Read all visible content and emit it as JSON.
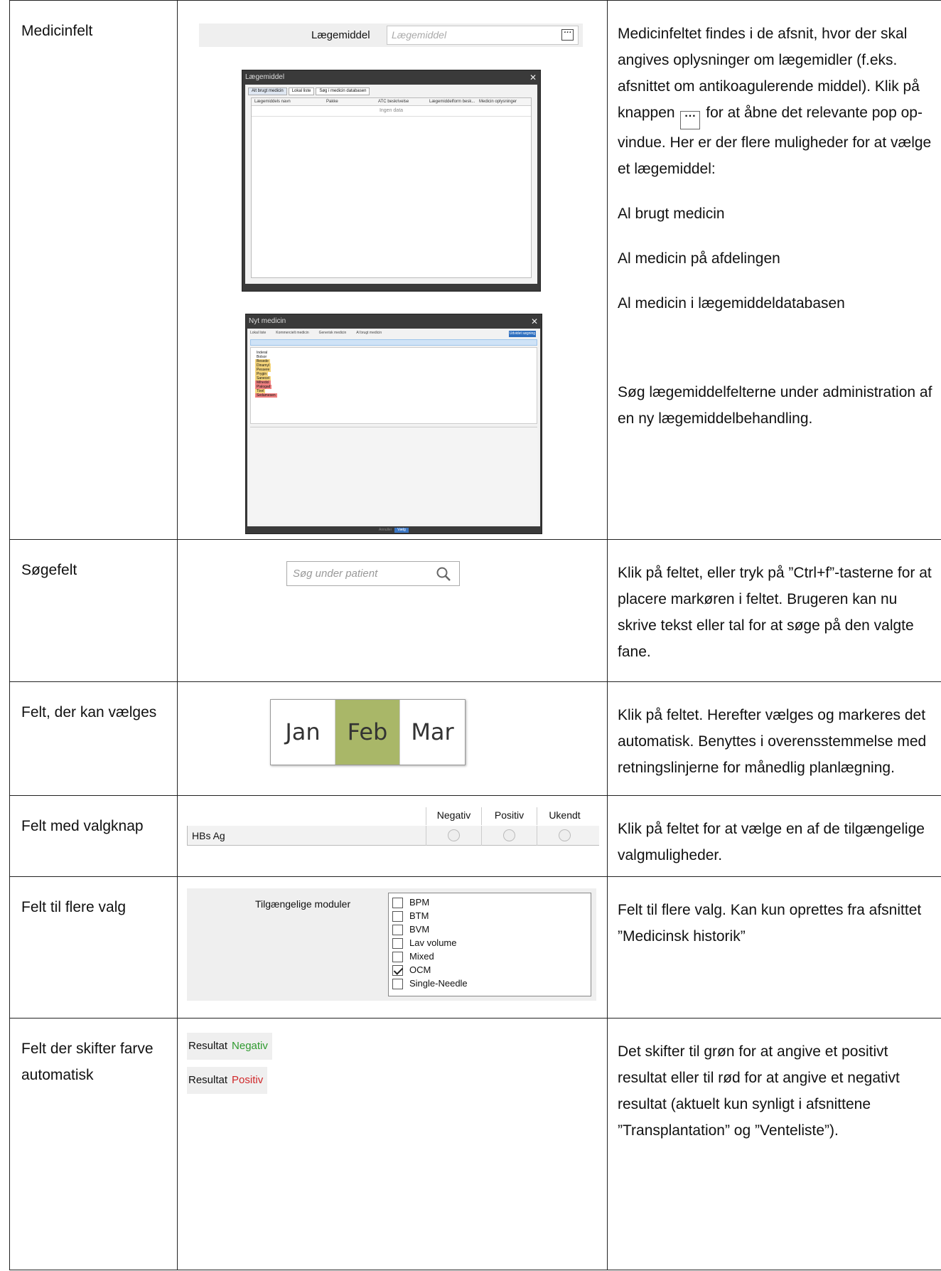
{
  "rows": [
    {
      "label": "Medicinfelt",
      "desc": {
        "p1_before": "Medicinfeltet findes i de afsnit, hvor der skal angives oplysninger om lægemidler (f.eks. afsnittet om antikoagulerende middel). Klik på knappen",
        "p1_button": "···",
        "p1_after": "for at åbne det relevante pop op-vindue. Her er der flere muligheder for at vælge et lægemiddel:",
        "p2": "Al brugt medicin",
        "p3": "Al medicin på afdelingen",
        "p4": "Al medicin i lægemiddeldatabasen",
        "p5": "Søg lægemiddelfelterne under administration af en ny lægemiddelbehandling."
      },
      "widget": {
        "field_label": "Lægemiddel",
        "field_placeholder": "Lægemiddel",
        "field_button": "···",
        "popup": {
          "title": "Lægemiddel",
          "close": "✕",
          "tabs": [
            "Alt brugt medicin",
            "Lokal liste",
            "Søg i medicin databasen"
          ],
          "columns": [
            "Lægemiddels navn",
            "Pakke",
            "ATC beskrivelse",
            "Lægemiddelform besk...",
            "Medicin oplysninger"
          ],
          "empty": "Ingen data"
        },
        "new_med": {
          "title": "Nyt medicin",
          "close": "✕",
          "options": [
            "Lokal liste",
            "Kommercielt medicin",
            "Generisk medicin",
            "Al brugt medicin"
          ],
          "action": "Udvidet søgning",
          "items": [
            "Inderal",
            "Bolsor",
            "Besede",
            "Dinamyl",
            "Pessere",
            "Prygin",
            "Sanecel",
            "Mihedol",
            "Plalogad",
            "Tixel",
            "Sedamesen"
          ],
          "cancel": "Annuller",
          "ok": "Vælg"
        }
      }
    },
    {
      "label": "Søgefelt",
      "desc": "Klik på feltet, eller tryk på ”Ctrl+f”-tasterne for at placere markøren i feltet. Brugeren kan nu skrive tekst eller tal for at søge på den valgte fane.",
      "widget": {
        "placeholder": "Søg under patient",
        "icon": "search-icon"
      }
    },
    {
      "label": "Felt, der kan vælges",
      "desc": "Klik på feltet. Herefter vælges og markeres det automatisk. Benyttes i overensstemmelse med retningslinjerne for månedlig planlægning.",
      "widget": {
        "months": [
          "Jan",
          "Feb",
          "Mar"
        ],
        "selected": "Feb",
        "selected_color": "#a9b768"
      }
    },
    {
      "label": "Felt med valgknap",
      "desc": "Klik på feltet for at vælge en af de tilgængelige valgmuligheder.",
      "widget": {
        "columns": [
          "Negativ",
          "Positiv",
          "Ukendt"
        ],
        "row_label": "HBs Ag"
      }
    },
    {
      "label": "Felt til flere valg",
      "desc": "Felt til flere valg. Kan kun oprettes fra afsnittet ”Medicinsk historik”",
      "widget": {
        "label": "Tilgængelige moduler",
        "options": [
          {
            "text": "BPM",
            "checked": false
          },
          {
            "text": "BTM",
            "checked": false
          },
          {
            "text": "BVM",
            "checked": false
          },
          {
            "text": "Lav volume",
            "checked": false
          },
          {
            "text": "Mixed",
            "checked": false
          },
          {
            "text": "OCM",
            "checked": true
          },
          {
            "text": "Single-Needle",
            "checked": false
          }
        ]
      }
    },
    {
      "label": "Felt der skifter farve automatisk",
      "desc": "Det skifter til grøn for at angive et positivt resultat eller til rød for at angive et negativt resultat (aktuelt kun synligt i afsnittene ”Transplantation” og ”Venteliste”).",
      "widget": {
        "items": [
          {
            "label": "Resultat",
            "value": "Negativ",
            "color": "#2e9a2e"
          },
          {
            "label": "Resultat",
            "value": "Positiv",
            "color": "#d0282a"
          }
        ]
      }
    }
  ]
}
